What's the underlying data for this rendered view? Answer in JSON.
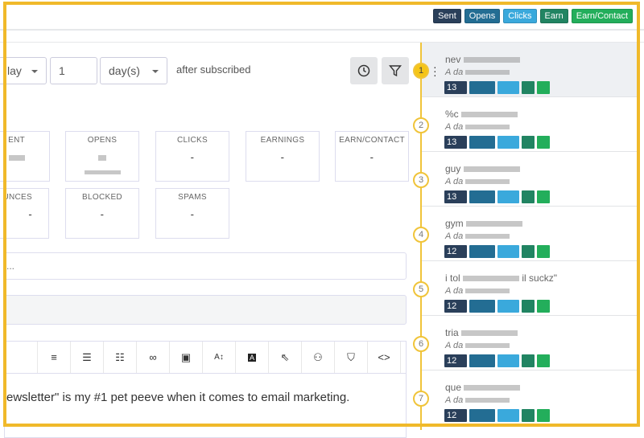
{
  "legend": [
    {
      "label": "Sent",
      "color": "#2a3f5a"
    },
    {
      "label": "Opens",
      "color": "#236d93"
    },
    {
      "label": "Clicks",
      "color": "#3aa9dc"
    },
    {
      "label": "Earn",
      "color": "#218462"
    },
    {
      "label": "Earn/Contact",
      "color": "#23ae5b"
    }
  ],
  "schedule": {
    "unit_select": "lay",
    "amount": "1",
    "period_select": "day(s)",
    "after_label": "after subscribed"
  },
  "icons": {
    "clock": "clock-icon",
    "filter": "filter-icon"
  },
  "stats": [
    {
      "label": "ENT",
      "value": ""
    },
    {
      "label": "OPENS",
      "value": ""
    },
    {
      "label": "CLICKS",
      "value": "-"
    },
    {
      "label": "EARNINGS",
      "value": "-"
    },
    {
      "label": "EARN/CONTACT",
      "value": "-"
    },
    {
      "label": "UNCES",
      "value": "-"
    },
    {
      "label": "BLOCKED",
      "value": "-"
    },
    {
      "label": "SPAMS",
      "value": "-"
    }
  ],
  "subject_placeholder": "...",
  "toolbar": [
    "align-left",
    "ordered-list",
    "unordered-list",
    "link",
    "image",
    "font-size",
    "text-color",
    "cursor",
    "user",
    "shield-check",
    "code"
  ],
  "editor_text": "ewsletter\" is my #1 pet peeve when it comes to email marketing.",
  "timeline": [
    {
      "n": "1",
      "title": "nev",
      "sub": "A da",
      "sent": "13"
    },
    {
      "n": "2",
      "title": "%c",
      "sub": "A da",
      "sent": "13"
    },
    {
      "n": "3",
      "title": "guy",
      "sub": "A da",
      "sent": "13"
    },
    {
      "n": "4",
      "title": "gym",
      "sub": "A da",
      "sent": "12"
    },
    {
      "n": "5",
      "title": "i tol",
      "title_end": "il suckz\"",
      "sub": "A da",
      "sent": "12"
    },
    {
      "n": "6",
      "title": "tria",
      "sub": "A da",
      "sent": "12"
    },
    {
      "n": "7",
      "title": "que",
      "sub": "A da",
      "sent": "12"
    }
  ]
}
